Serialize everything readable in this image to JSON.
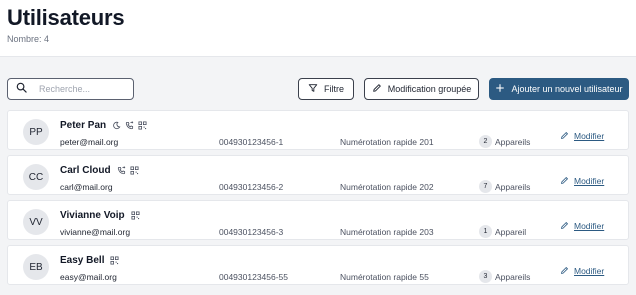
{
  "header": {
    "title": "Utilisateurs",
    "count": "Nombre: 4"
  },
  "toolbar": {
    "search_placeholder": "Recherche...",
    "filter_label": "Filtre",
    "bulk_edit_label": "Modification groupée",
    "add_user_label": "Ajouter un nouvel utilisateur"
  },
  "colors": {
    "primary": "#2c5a82",
    "avatar_bg": "#e5e7eb",
    "border": "#e5e7eb"
  },
  "users": [
    {
      "initials": "PP",
      "name": "Peter Pan",
      "email": "peter@mail.org",
      "number": "004930123456-1",
      "speed_dial": "Numérotation rapide 201",
      "device_count": "2",
      "device_label": "Appareils",
      "edit_label": "Modifier",
      "features": [
        "moon-icon",
        "phone-forward-icon",
        "qr-icon"
      ]
    },
    {
      "initials": "CC",
      "name": "Carl Cloud",
      "email": "carl@mail.org",
      "number": "004930123456-2",
      "speed_dial": "Numérotation rapide 202",
      "device_count": "7",
      "device_label": "Appareils",
      "edit_label": "Modifier",
      "features": [
        "phone-forward-icon",
        "qr-icon"
      ]
    },
    {
      "initials": "VV",
      "name": "Vivianne Voip",
      "email": "vivianne@mail.org",
      "number": "004930123456-3",
      "speed_dial": "Numérotation rapide 203",
      "device_count": "1",
      "device_label": "Appareil",
      "edit_label": "Modifier",
      "features": [
        "qr-icon"
      ]
    },
    {
      "initials": "EB",
      "name": "Easy Bell",
      "email": "easy@mail.org",
      "number": "004930123456-55",
      "speed_dial": "Numérotation rapide 55",
      "device_count": "3",
      "device_label": "Appareils",
      "edit_label": "Modifier",
      "features": [
        "qr-icon"
      ]
    }
  ]
}
